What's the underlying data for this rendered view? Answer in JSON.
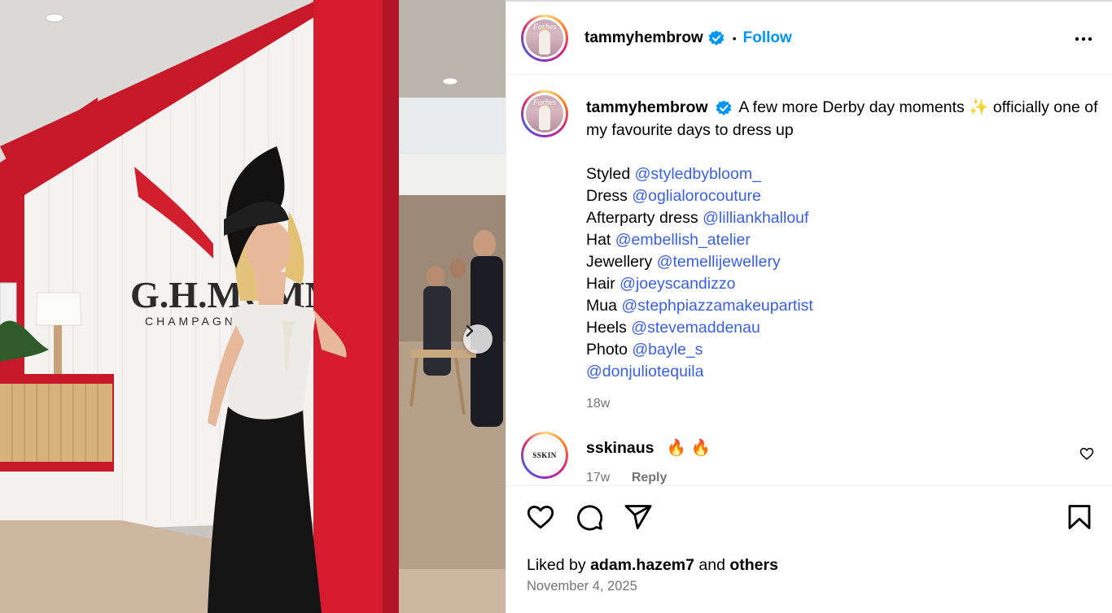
{
  "post": {
    "username": "tammyhembrow",
    "follow_label": "Follow",
    "separator": "•",
    "avatar_text": "Forbes"
  },
  "caption": {
    "username": "tammyhembrow",
    "text": "A few more Derby day moments ✨ officially one of my favourite days to dress up",
    "credits": [
      {
        "label": "Styled ",
        "mention": "@styledbybloom_"
      },
      {
        "label": "Dress ",
        "mention": "@oglialorocouture"
      },
      {
        "label": "Afterparty dress ",
        "mention": "@lilliankhallouf"
      },
      {
        "label": "Hat ",
        "mention": "@embellish_atelier"
      },
      {
        "label": "Jewellery ",
        "mention": "@temellijewellery"
      },
      {
        "label": "Hair ",
        "mention": "@joeyscandizzo"
      },
      {
        "label": "Mua ",
        "mention": "@stephpiazzamakeupartist"
      },
      {
        "label": "Heels ",
        "mention": "@stevemaddenau"
      },
      {
        "label": "Photo ",
        "mention": "@bayle_s"
      },
      {
        "label": "",
        "mention": "@donjuliotequila"
      }
    ],
    "time": "18w"
  },
  "comment": {
    "username": "sskinaus",
    "text": "🔥 🔥",
    "avatar_text": "SSKIN",
    "time": "17w",
    "reply_label": "Reply"
  },
  "photo_signage": {
    "brand": "G.H.MUMM",
    "sub": "CHAMPAGNE"
  },
  "likes": {
    "prefix": "Liked by ",
    "user": "adam.hazem7",
    "middle": " and ",
    "suffix": "others"
  },
  "date": "November 4, 2025",
  "icons": {
    "verified": "verified-badge-icon",
    "more": "more-options-icon",
    "like": "heart-icon",
    "comment": "comment-bubble-icon",
    "share": "paper-plane-icon",
    "save": "bookmark-icon",
    "next": "chevron-right-icon"
  },
  "colors": {
    "accent": "#0095f6",
    "mention": "#385fe8",
    "secondary_text": "#737373"
  }
}
